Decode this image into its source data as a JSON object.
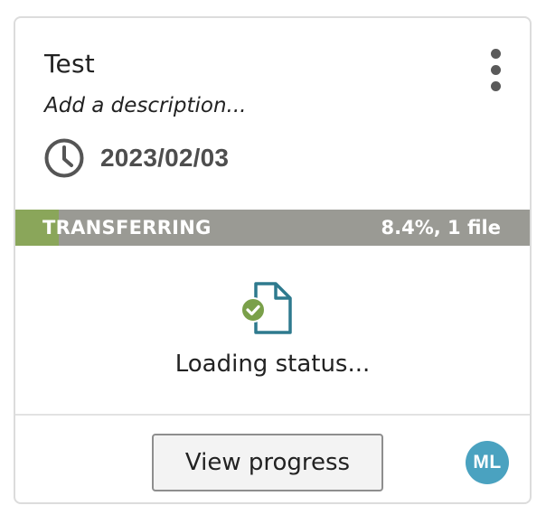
{
  "card": {
    "title": "Test",
    "description_placeholder": "Add a description...",
    "date": "2023/02/03",
    "menu_icon": "kebab-menu-icon",
    "clock_icon": "clock-icon"
  },
  "status_bar": {
    "label": "TRANSFERRING",
    "progress_text": "8.4%, 1 file",
    "progress_percent": 8.4,
    "fill_color": "#8aa65a",
    "track_color": "#9a9a94"
  },
  "status_section": {
    "icon": "file-check-icon",
    "file_icon_color": "#2e7a8e",
    "check_color": "#7aa04a",
    "text": "Loading status..."
  },
  "footer": {
    "button_label": "View progress",
    "avatar_initials": "ML",
    "avatar_color": "#4aa2c0"
  }
}
